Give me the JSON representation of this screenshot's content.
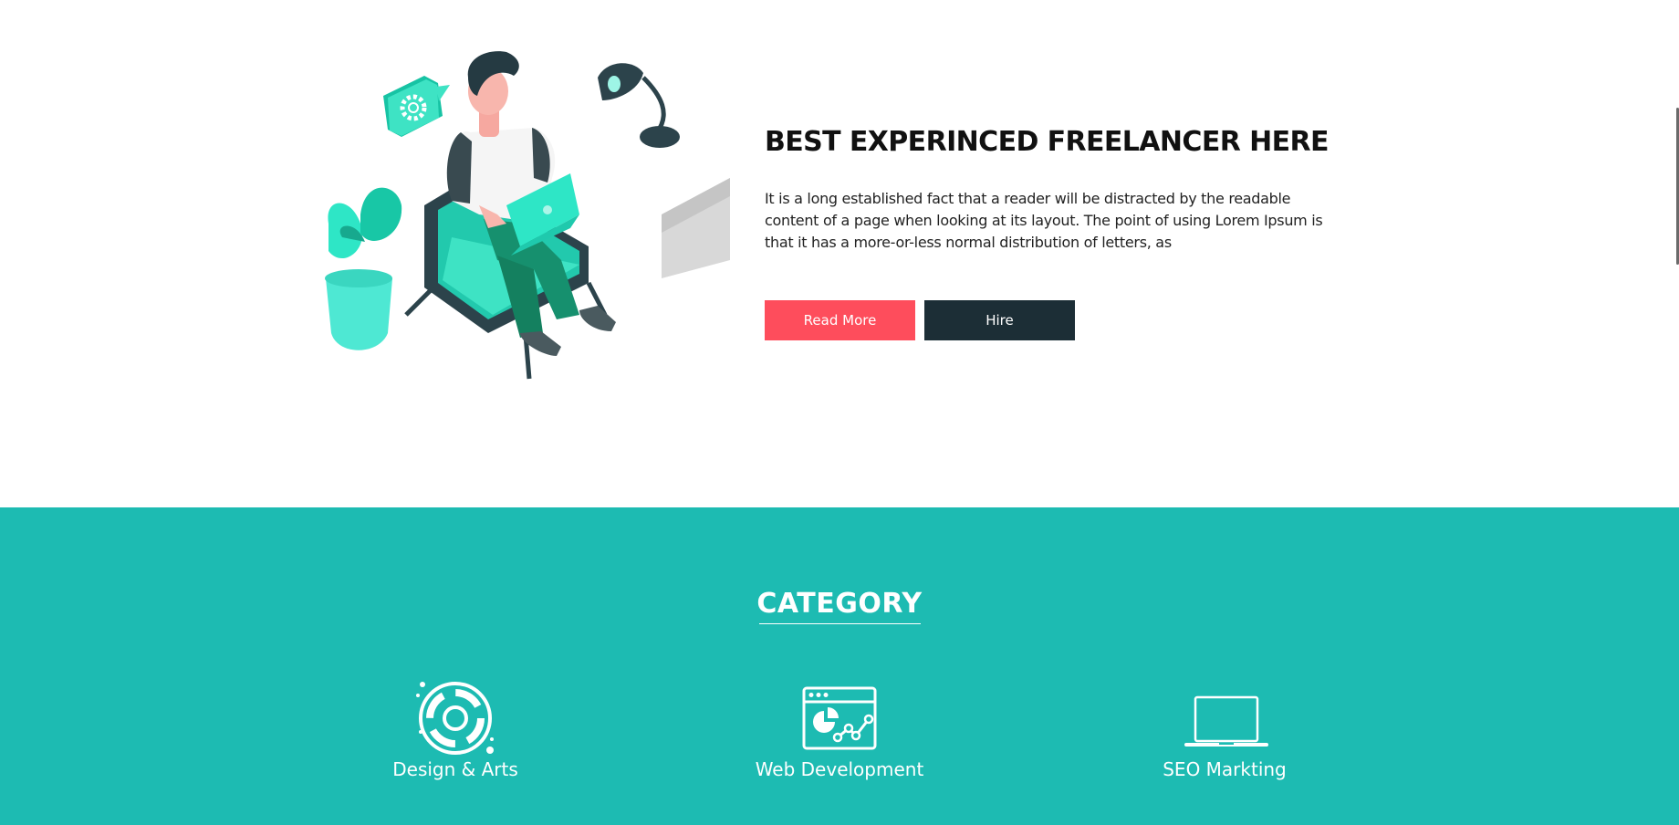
{
  "hero": {
    "title": "BEST EXPERINCED FREELANCER HERE",
    "description": "It is a long established fact that a reader will be distracted by the readable content of a page when looking at its layout. The point of using Lorem Ipsum is that it has a more-or-less normal distribution of letters, as",
    "read_more_label": "Read More",
    "hire_label": "Hire",
    "illustration_icon": "freelancer-on-chair-illustration"
  },
  "category": {
    "title": "CATEGORY",
    "items": [
      {
        "label": "Design & Arts",
        "icon": "design-arts-icon"
      },
      {
        "label": "Web Development",
        "icon": "web-development-icon"
      },
      {
        "label": "SEO Markting",
        "icon": "laptop-icon"
      }
    ]
  },
  "colors": {
    "accent_red": "#fe4d5c",
    "dark_button": "#1c2e36",
    "teal_section": "#1dbbb2",
    "illustration_teal": "#2ee6c6"
  }
}
